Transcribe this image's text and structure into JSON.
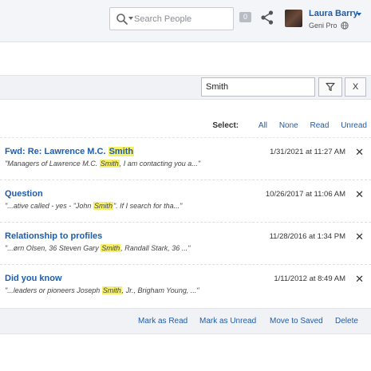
{
  "header": {
    "search_placeholder": "Search People",
    "notification_count": "0",
    "user_name": "Laura Barry",
    "user_plan": "Geni Pro",
    "icons": [
      "search-icon",
      "chevron-down-icon",
      "share-icon",
      "avatar",
      "globe-icon"
    ]
  },
  "filter": {
    "value": "Smith",
    "clear_label": "X"
  },
  "select": {
    "label": "Select:",
    "options": [
      "All",
      "None",
      "Read",
      "Unread"
    ]
  },
  "messages": [
    {
      "subject": {
        "before": "Fwd: Re: Lawrence M.C. ",
        "match": "Smith",
        "after": ""
      },
      "snippet": {
        "before": "\"Managers of Lawrence M.C. ",
        "match": "Smith",
        "after": ", I am contacting you a...\""
      },
      "date": "1/31/2021 at 11:27 AM"
    },
    {
      "subject": {
        "before": "Question",
        "match": "",
        "after": ""
      },
      "snippet": {
        "before": "\"...ative called - yes - \"John ",
        "match": "Smith",
        "after": "\". If I search for tha...\""
      },
      "date": "10/26/2017 at 11:06 AM"
    },
    {
      "subject": {
        "before": "Relationship to profiles",
        "match": "",
        "after": ""
      },
      "snippet": {
        "before": "\"...ørn Olsen, 36 Steven Gary ",
        "match": "Smith",
        "after": ", Randall Stark, 36 ...\""
      },
      "date": "11/28/2016 at 1:34 PM"
    },
    {
      "subject": {
        "before": "Did you know",
        "match": "",
        "after": ""
      },
      "snippet": {
        "before": "\"...leaders or pioneers Joseph ",
        "match": "Smith",
        "after": ", Jr., Brigham Young, ...\""
      },
      "date": "1/11/2012 at 8:49 AM"
    }
  ],
  "delete_glyph": "✕",
  "actions": {
    "mark_read": "Mark as Read",
    "mark_unread": "Mark as Unread",
    "move_saved": "Move to Saved",
    "delete": "Delete"
  },
  "colors": {
    "link": "#1f5cab",
    "highlight": "#f5f06b"
  }
}
